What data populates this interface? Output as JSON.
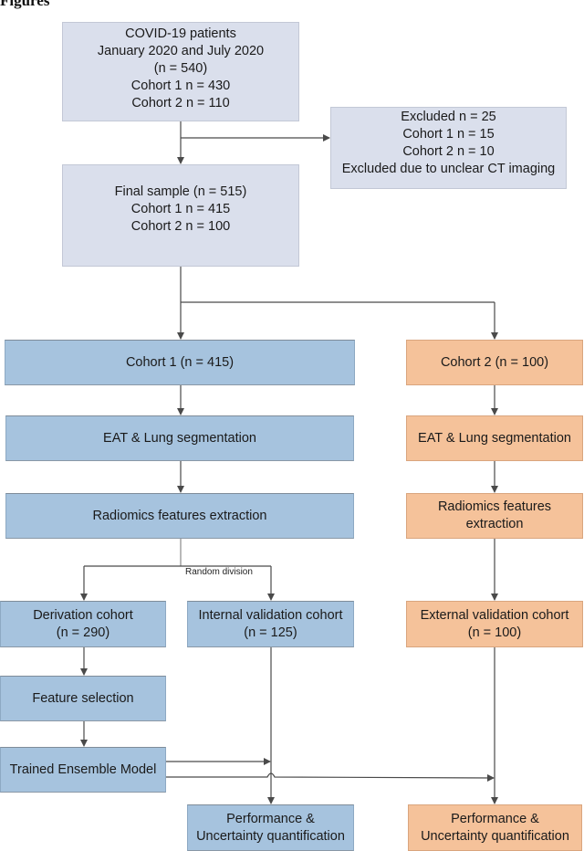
{
  "heading": "Figures",
  "boxes": {
    "patients": {
      "lines": [
        "COVID-19 patients",
        "January 2020 and July 2020",
        "(n = 540)",
        "Cohort 1 n = 430",
        "Cohort 2 n = 110"
      ]
    },
    "excluded": {
      "lines": [
        "Excluded n = 25",
        "Cohort 1 n = 15",
        "Cohort 2 n = 10",
        "Excluded due to unclear CT imaging"
      ]
    },
    "final": {
      "lines": [
        "Final sample (n = 515)",
        "Cohort 1 n = 415",
        "Cohort 2 n = 100"
      ]
    },
    "cohort1": {
      "lines": [
        "Cohort 1 (n = 415)"
      ]
    },
    "cohort2": {
      "lines": [
        "Cohort 2 (n = 100)"
      ]
    },
    "seg1": {
      "lines": [
        "EAT & Lung segmentation"
      ]
    },
    "seg2": {
      "lines": [
        "EAT & Lung segmentation"
      ]
    },
    "rad1": {
      "lines": [
        "Radiomics features extraction"
      ]
    },
    "rad2": {
      "lines": [
        "Radiomics features",
        "extraction"
      ]
    },
    "derivation": {
      "lines": [
        "Derivation cohort",
        "(n = 290)"
      ]
    },
    "internal": {
      "lines": [
        "Internal validation cohort",
        "(n = 125)"
      ]
    },
    "external": {
      "lines": [
        "External validation cohort",
        "(n = 100)"
      ]
    },
    "feature": {
      "lines": [
        "Feature selection"
      ]
    },
    "trained": {
      "lines": [
        "Trained Ensemble Model"
      ]
    },
    "perf1": {
      "lines": [
        "Performance &",
        "Uncertainty quantification"
      ]
    },
    "perf2": {
      "lines": [
        "Performance &",
        "Uncertainty quantification"
      ]
    }
  },
  "labels": {
    "random_division": "Random division"
  },
  "colors": {
    "gray": "#dadfec",
    "blue": "#a6c3de",
    "orange": "#f5c29a",
    "line": "#4a4a4a"
  }
}
